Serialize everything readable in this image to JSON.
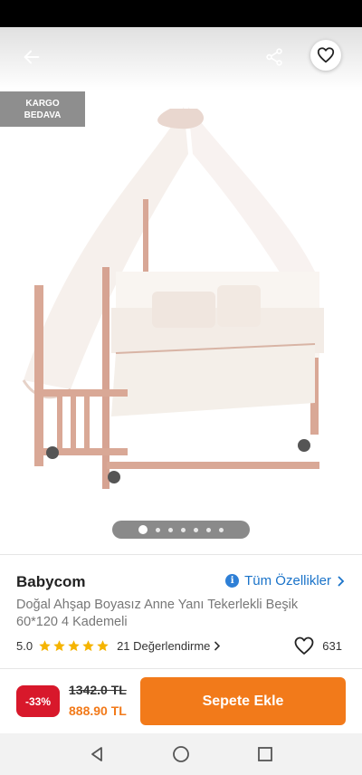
{
  "gallery": {
    "badge_line1": "KARGO",
    "badge_line2": "BEDAVA",
    "image_count": 7,
    "active_image_index": 0
  },
  "product": {
    "brand": "Babycom",
    "all_specs_label": "Tüm Özellikler",
    "title": "Doğal Ahşap Boyasız Anne Yanı Tekerlekli Beşik 60*120 4 Kademeli",
    "rating": "5.0",
    "rating_stars": 5,
    "reviews_label": "21 Değerlendirme",
    "favorite_count": "631"
  },
  "purchase": {
    "discount": "-33%",
    "old_price": "1342.0 TL",
    "new_price": "888.90 TL",
    "add_to_cart_label": "Sepete Ekle"
  },
  "icons": {
    "back": "arrow-left-icon",
    "share": "share-icon",
    "favorite": "heart-icon",
    "info": "info-icon",
    "star": "star-icon",
    "chevron": "chevron-right-icon"
  },
  "colors": {
    "accent_orange": "#f27a1a",
    "discount_red": "#d8182b",
    "link_blue": "#1a73c9",
    "star_yellow": "#f5b400",
    "badge_gray": "#8e8e8e"
  }
}
